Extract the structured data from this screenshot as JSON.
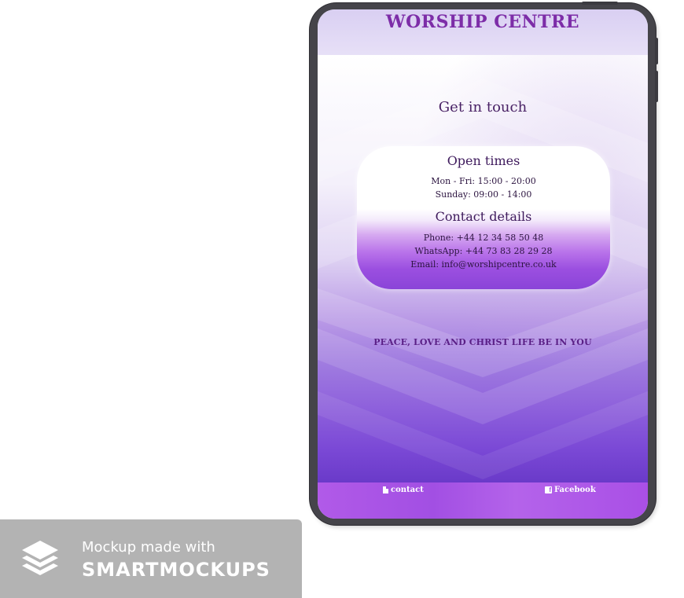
{
  "site": {
    "title": "WORSHIP CENTRE"
  },
  "page": {
    "heading": "Get in touch",
    "tagline": "PEACE, LOVE AND CHRIST LIFE BE IN YOU"
  },
  "card": {
    "open_times_title": "Open times",
    "hours_weekdays": "Mon - Fri: 15:00 - 20:00",
    "hours_sunday": "Sunday: 09:00 - 14:00",
    "contact_title": "Contact details",
    "phone": "Phone: +44 12 34 58 50 48",
    "whatsapp": "WhatsApp: +44 73 83 28 29 28",
    "email": "Email: info@worshipcentre.co.uk"
  },
  "footer": {
    "contact_label": "contact",
    "contact_icon": "document-icon",
    "facebook_label": "Facebook",
    "facebook_icon": "facebook-icon"
  },
  "watermark": {
    "line1": "Mockup made with",
    "line2": "SMARTMOCKUPS",
    "icon": "layers-icon"
  },
  "colors": {
    "brand_purple": "#7d2da8",
    "footer_purple": "#a24fe3",
    "device_frame": "#45444a",
    "watermark_bg": "#b3b3b3"
  }
}
